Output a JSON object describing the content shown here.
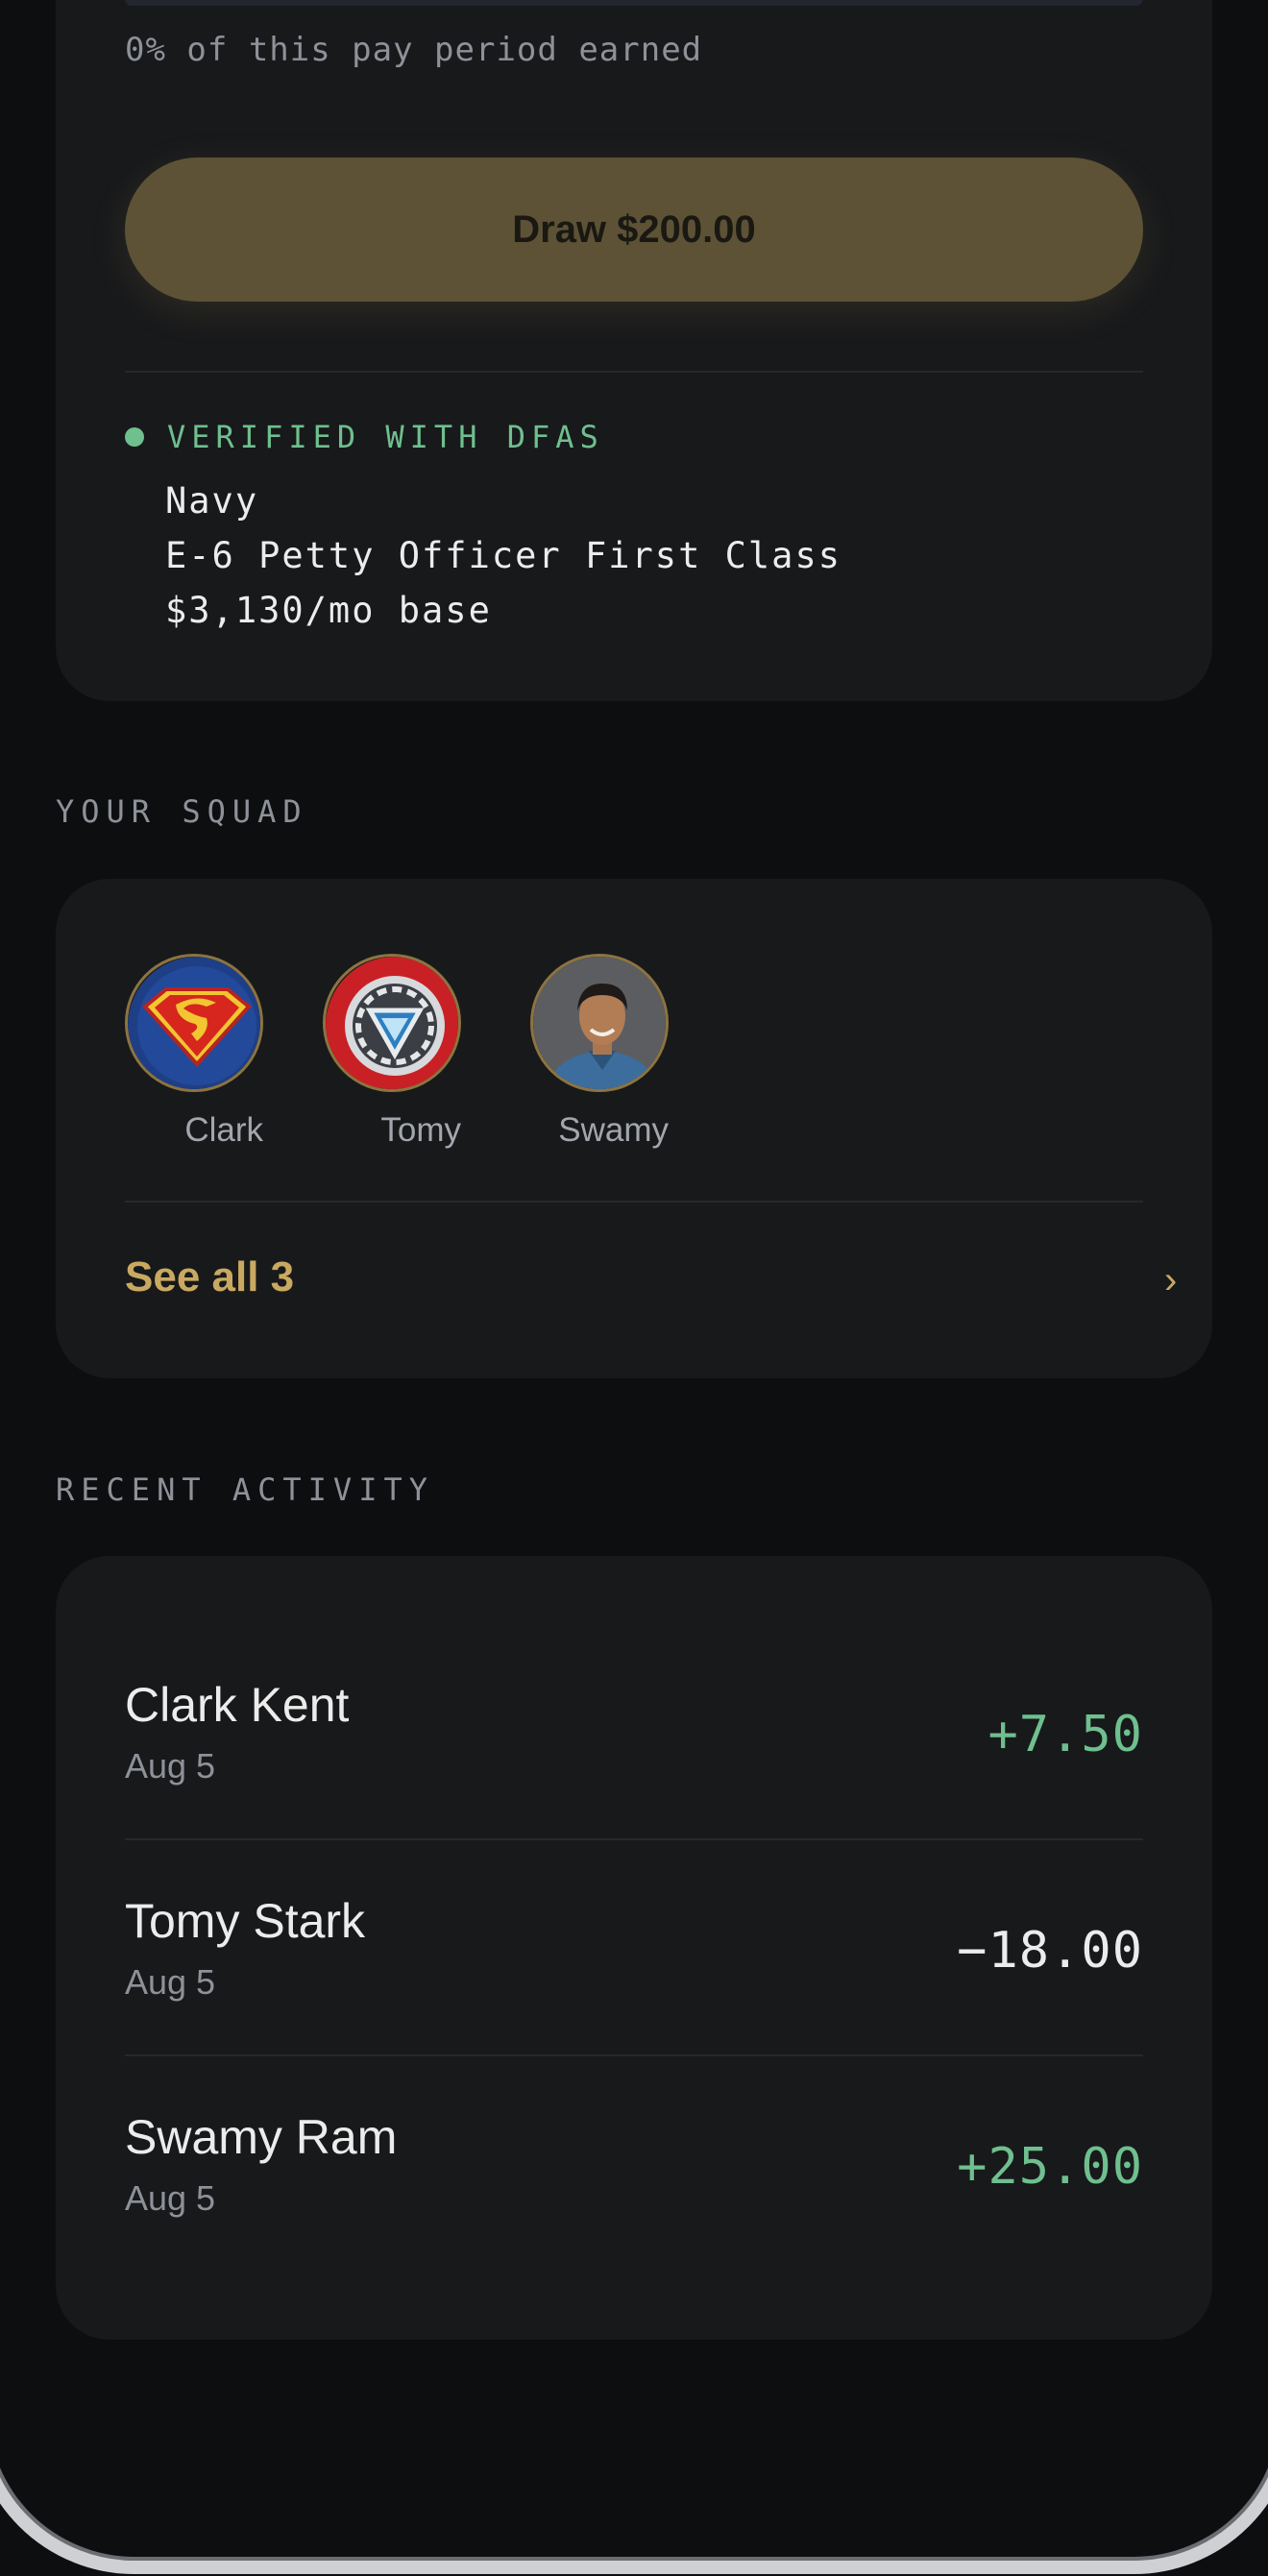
{
  "pay": {
    "progress_fraction": 0,
    "earned_text": "0% of this pay period earned",
    "draw_label": "Draw $200.00"
  },
  "verification": {
    "label": "VERIFIED WITH DFAS",
    "branch": "Navy",
    "rank": "E-6 Petty Officer First Class",
    "base_pay": "$3,130/mo base"
  },
  "squad": {
    "section_label": "YOUR SQUAD",
    "members": [
      {
        "name": "Clark",
        "avatar": "superman-logo-icon"
      },
      {
        "name": "Tomy",
        "avatar": "arc-reactor-icon"
      },
      {
        "name": "Swamy",
        "avatar": "person-photo"
      }
    ],
    "see_all_label": "See all 3"
  },
  "activity": {
    "section_label": "RECENT ACTIVITY",
    "items": [
      {
        "name": "Clark Kent",
        "date": "Aug 5",
        "amount": "+7.50",
        "positive": true
      },
      {
        "name": "Tomy Stark",
        "date": "Aug 5",
        "amount": "−18.00",
        "positive": false
      },
      {
        "name": "Swamy Ram",
        "date": "Aug 5",
        "amount": "+25.00",
        "positive": true
      }
    ]
  },
  "colors": {
    "accent": "#c9a961",
    "positive": "#6fbf8f",
    "background": "#0d0e10",
    "card": "#18191b"
  }
}
